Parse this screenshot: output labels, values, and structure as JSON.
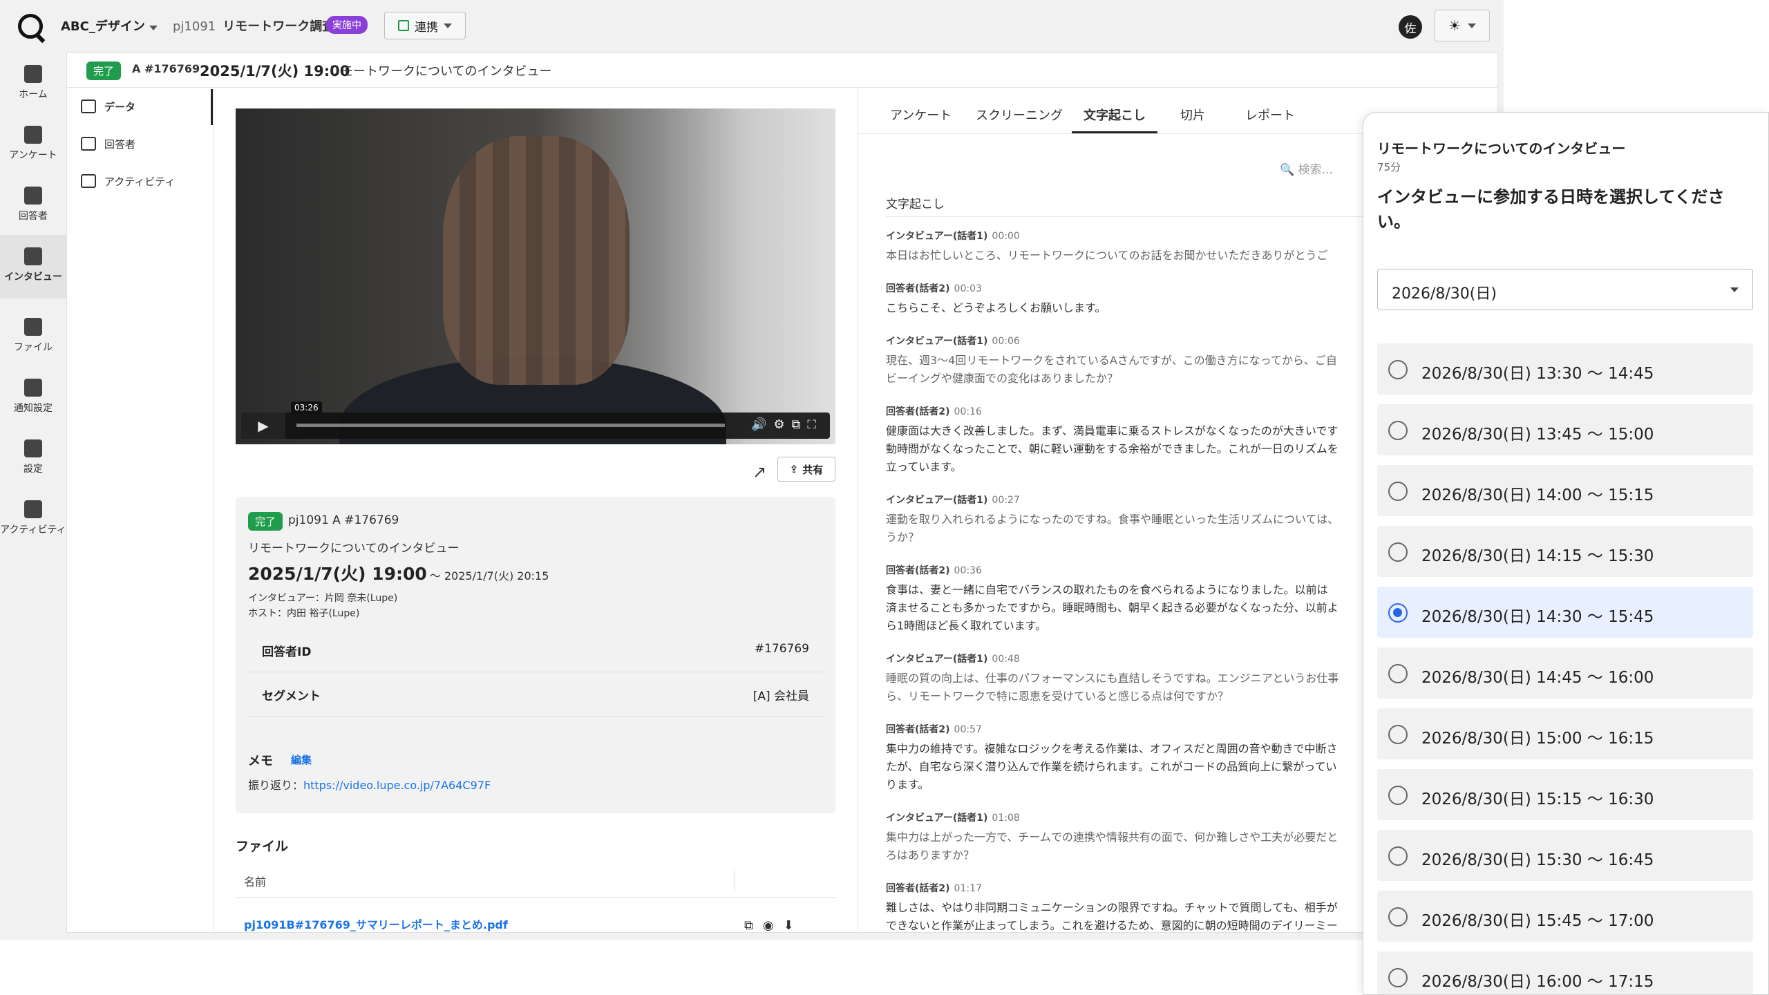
{
  "topbar": {
    "org": "ABC_デザイン",
    "project_id": "pj1091",
    "project_name": "リモートワーク調査",
    "status_badge": "実施中",
    "link_button": "連携",
    "avatar": "佐"
  },
  "nav": [
    {
      "label": "ホーム",
      "icon": "home-icon"
    },
    {
      "label": "アンケート",
      "icon": "chart-icon"
    },
    {
      "label": "回答者",
      "icon": "person-icon"
    },
    {
      "label": "インタビュー",
      "icon": "chat-icon",
      "active": true
    },
    {
      "label": "ファイル",
      "icon": "folder-icon"
    },
    {
      "label": "通知設定",
      "icon": "bell-icon"
    },
    {
      "label": "設定",
      "icon": "gear-icon"
    },
    {
      "label": "アクティビティ",
      "icon": "inbox-icon"
    }
  ],
  "header": {
    "status": "完了",
    "respondent": "A #176769",
    "datetime": "2025/1/7(火) 19:00",
    "title": "リモートワークについてのインタビュー"
  },
  "subnav": [
    {
      "label": "データ",
      "active": true
    },
    {
      "label": "回答者"
    },
    {
      "label": "アクティビティ"
    }
  ],
  "video": {
    "time_tooltip": "03:26"
  },
  "share_button": "共有",
  "info": {
    "status": "完了",
    "pid": "pj1091 A #176769",
    "title": "リモートワークについてのインタビュー",
    "date": "2025/1/7(火) 19:00",
    "end": "〜 2025/1/7(火) 20:15",
    "interviewer": "インタビュアー：片岡 奈未(Lupe)",
    "host": "ホスト：内田 裕子(Lupe)",
    "respondent_id_label": "回答者ID",
    "respondent_id": "#176769",
    "segment_label": "セグメント",
    "segment": "[A] 会社員",
    "memo_label": "メモ",
    "memo_edit": "編集",
    "memo_prefix": "振り返り：",
    "memo_link": "https://video.lupe.co.jp/7A64C97F"
  },
  "files": {
    "title": "ファイル",
    "col_name": "名前",
    "file": "pj1091B#176769_サマリーレポート_まとめ.pdf"
  },
  "tabs": [
    "アンケート",
    "スクリーニング",
    "文字起こし",
    "切片",
    "レポート"
  ],
  "search_placeholder": "検索...",
  "transcript": {
    "title": "文字起こし",
    "entries": [
      {
        "speaker": "インタビュアー(話者1)",
        "time": "00:00",
        "text": "本日はお忙しいところ、リモートワークについてのお話をお聞かせいただきありがとうご"
      },
      {
        "speaker": "回答者(話者2)",
        "time": "00:03",
        "text": "こちらこそ、どうぞよろしくお願いします。"
      },
      {
        "speaker": "インタビュアー(話者1)",
        "time": "00:06",
        "text": "現在、週3〜4回リモートワークをされているAさんですが、この働き方になってから、ご自\nビーイングや健康面での変化はありましたか？"
      },
      {
        "speaker": "回答者(話者2)",
        "time": "00:16",
        "text": "健康面は大きく改善しました。まず、満員電車に乗るストレスがなくなったのが大きいです\n動時間がなくなったことで、朝に軽い運動をする余裕ができました。これが一日のリズムを\n立っています。"
      },
      {
        "speaker": "インタビュアー(話者1)",
        "time": "00:27",
        "text": "運動を取り入れられるようになったのですね。食事や睡眠といった生活リズムについては、\nうか？"
      },
      {
        "speaker": "回答者(話者2)",
        "time": "00:36",
        "text": "食事は、妻と一緒に自宅でバランスの取れたものを食べられるようになりました。以前は\n済ませることも多かったですから。睡眠時間も、朝早く起きる必要がなくなった分、以前よ\nら1時間ほど長く取れています。"
      },
      {
        "speaker": "インタビュアー(話者1)",
        "time": "00:48",
        "text": "睡眠の質の向上は、仕事のパフォーマンスにも直結しそうですね。エンジニアというお仕事\nら、リモートワークで特に恩恵を受けていると感じる点は何ですか？"
      },
      {
        "speaker": "回答者(話者2)",
        "time": "00:57",
        "text": "集中力の維持です。複雑なロジックを考える作業は、オフィスだと周囲の音や動きで中断さ\nたが、自宅なら深く潜り込んで作業を続けられます。これがコードの品質向上に繋がってい\nります。"
      },
      {
        "speaker": "インタビュアー(話者1)",
        "time": "01:08",
        "text": "集中力は上がった一方で、チームでの連携や情報共有の面で、何か難しさや工夫が必要だと\nろはありますか？"
      },
      {
        "speaker": "回答者(話者2)",
        "time": "01:17",
        "text": "難しさは、やはり非同期コミュニケーションの限界ですね。チャットで質問しても、相手が\nできないと作業が止まってしまう。これを避けるため、意図的に朝の短時間のデイリーミー"
      }
    ]
  },
  "popup": {
    "title": "リモートワークについてのインタビュー",
    "duration": "75分",
    "question": "インタビューに参加する日時を選択してください。",
    "selected_date": "2026/8/30(日)",
    "slots": [
      {
        "label": "2026/8/30(日) 13:30 〜 14:45",
        "selected": false
      },
      {
        "label": "2026/8/30(日) 13:45 〜 15:00",
        "selected": false
      },
      {
        "label": "2026/8/30(日) 14:00 〜 15:15",
        "selected": false
      },
      {
        "label": "2026/8/30(日) 14:15 〜 15:30",
        "selected": false
      },
      {
        "label": "2026/8/30(日) 14:30 〜 15:45",
        "selected": true
      },
      {
        "label": "2026/8/30(日) 14:45 〜 16:00",
        "selected": false
      },
      {
        "label": "2026/8/30(日) 15:00 〜 16:15",
        "selected": false
      },
      {
        "label": "2026/8/30(日) 15:15 〜 16:30",
        "selected": false
      },
      {
        "label": "2026/8/30(日) 15:30 〜 16:45",
        "selected": false
      },
      {
        "label": "2026/8/30(日) 15:45 〜 17:00",
        "selected": false
      },
      {
        "label": "2026/8/30(日) 16:00 〜 17:15",
        "selected": false
      }
    ]
  },
  "colors": {
    "done_badge": "#1f9d4c",
    "active_badge": "#8b3fd9",
    "link": "#1a73e8",
    "selected_radio": "#2a66e8"
  }
}
